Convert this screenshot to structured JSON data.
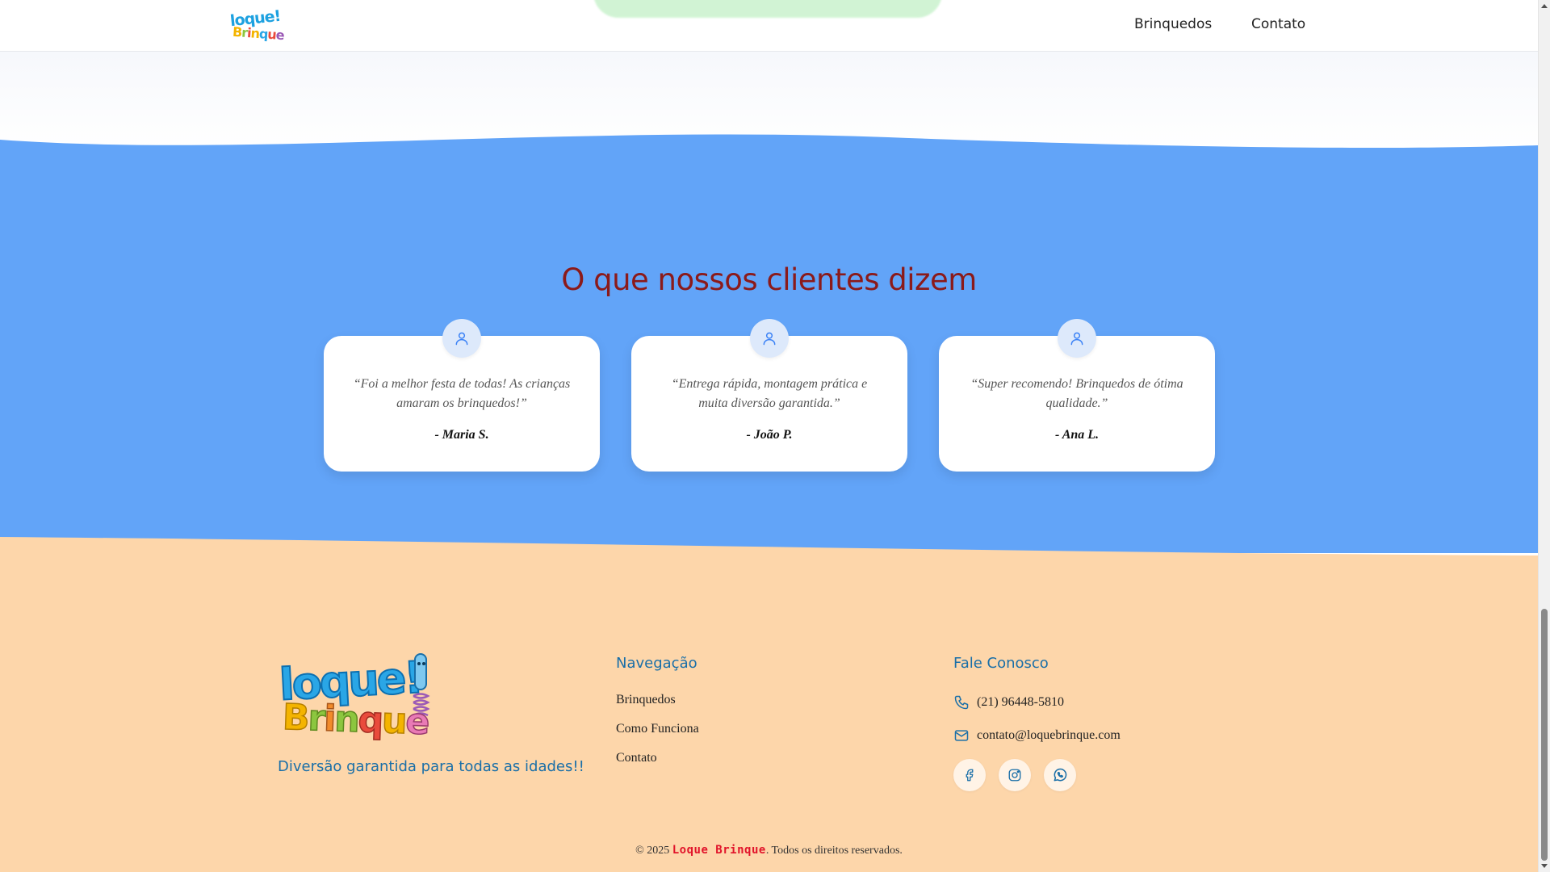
{
  "header": {
    "logo_line1": "loque!",
    "logo_line2": "Brinque",
    "nav": [
      "Brinquedos",
      "Contato"
    ]
  },
  "testimonials": {
    "title": "O que nossos clientes dizem",
    "items": [
      {
        "quote": "“Foi a melhor festa de todas! As crianças amaram os brinquedos!”",
        "author": "- Maria S.",
        "icon": "user-icon"
      },
      {
        "quote": "“Entrega rápida, montagem prática e muita diversão garantida.”",
        "author": "- João P.",
        "icon": "user-icon"
      },
      {
        "quote": "“Super recomendo! Brinquedos de ótima qualidade.”",
        "author": "- Ana L.",
        "icon": "user-icon"
      }
    ]
  },
  "footer": {
    "logo_line1": "loque!",
    "logo_line2": "Brinque",
    "tagline": "Diversão garantida para todas as idades!!",
    "nav_title": "Navegação",
    "nav_links": [
      "Brinquedos",
      "Como Funciona",
      "Contato"
    ],
    "contact_title": "Fale Conosco",
    "phone": "(21) 96448-5810",
    "email": "contato@loquebrinque.com",
    "social_icons": [
      "facebook-icon",
      "instagram-icon",
      "whatsapp-icon"
    ],
    "copyright_prefix": "© 2025",
    "copyright_brand": "Loque Brinque",
    "copyright_suffix": ". Todos os direitos reservados."
  },
  "colors": {
    "blue_section": "#62a4f8",
    "footer_bg": "#fdd6aa",
    "title_red": "#8b1a1a",
    "accent_blue": "#1a6fa8",
    "brand_red": "#e1142a"
  }
}
